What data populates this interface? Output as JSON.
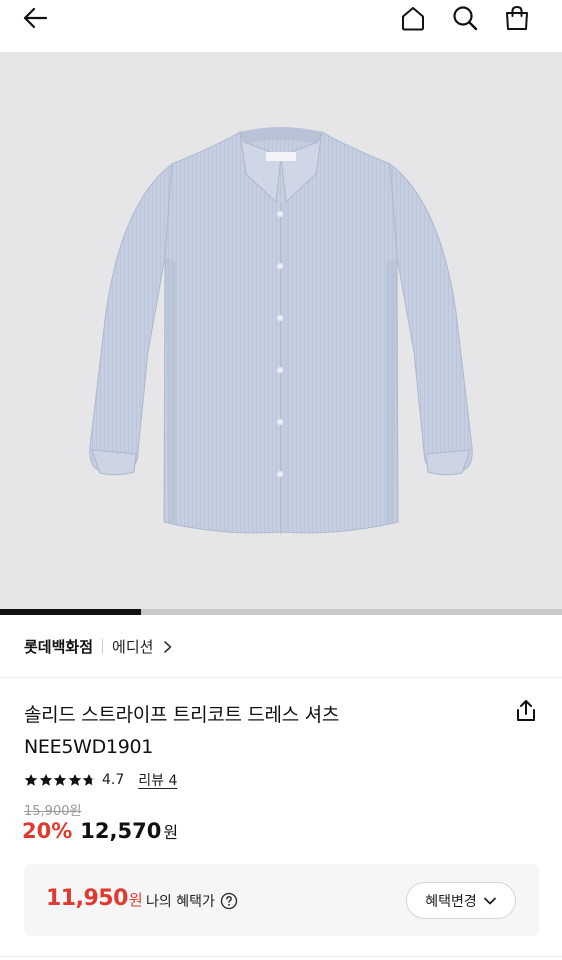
{
  "header": {
    "back_icon": "arrow-left-icon",
    "home_icon": "home-icon",
    "search_icon": "search-icon",
    "bag_icon": "shopping-bag-icon"
  },
  "gallery": {
    "image_alt": "Light blue striped long-sleeve dress shirt",
    "progress_fraction": 0.25,
    "background": "#e6e6e8",
    "shirt_color": "#c5cee0"
  },
  "brand": {
    "store": "롯데백화점",
    "label": "에디션"
  },
  "product": {
    "name_line1": "솔리드 스트라이프 트리코트 드레스 셔츠",
    "name_line2": "NEE5WD1901",
    "share_icon": "share-icon"
  },
  "rating": {
    "stars": 4.7,
    "value_text": "4.7",
    "review_text": "리뷰 4"
  },
  "price": {
    "original": "15,900원",
    "discount": "20%",
    "sale": "12,570",
    "currency": "원",
    "accent_color": "#e03a2f"
  },
  "benefit": {
    "amount": "11,950",
    "currency": "원",
    "label": "나의 혜택가",
    "button_label": "혜택변경"
  }
}
